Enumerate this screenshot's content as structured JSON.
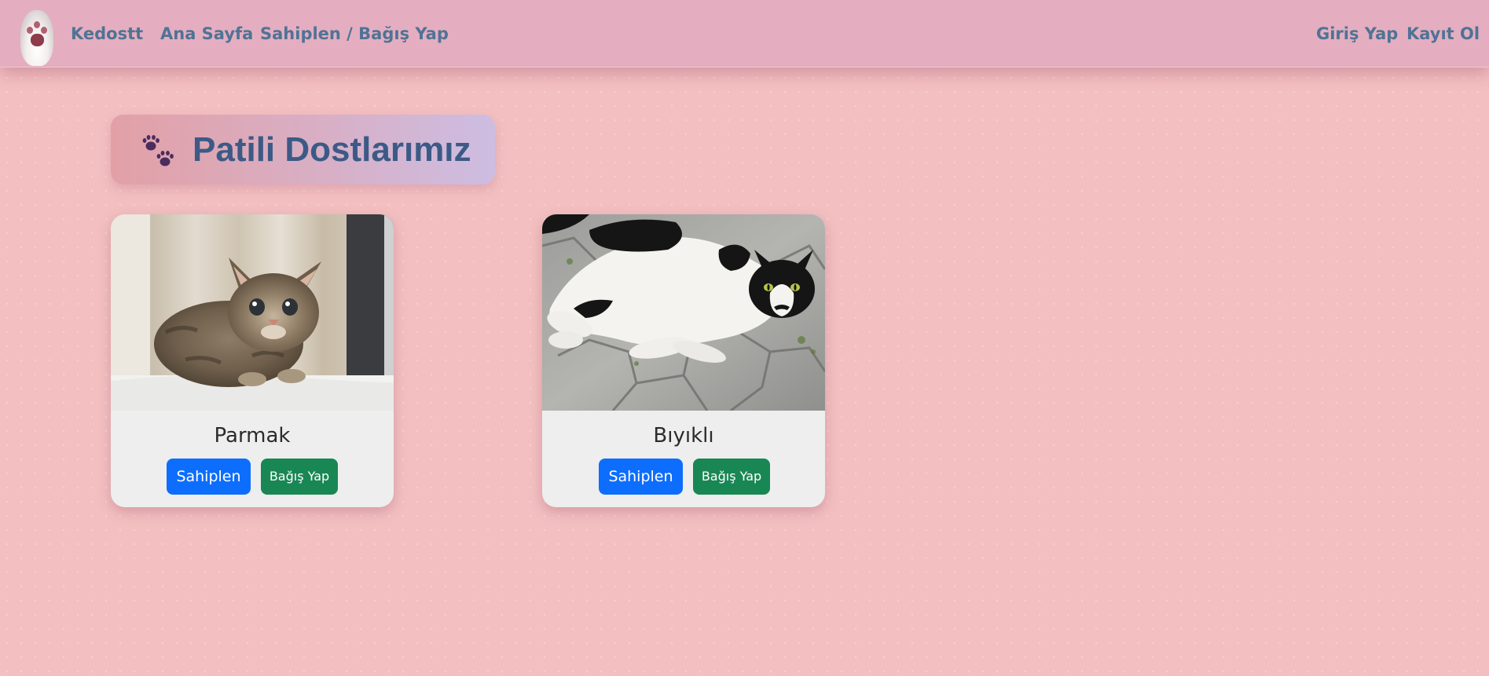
{
  "navbar": {
    "brand": "Kedostt",
    "links": {
      "home": "Ana Sayfa",
      "adopt_donate": "Sahiplen / Bağış Yap",
      "login": "Giriş Yap",
      "register": "Kayıt Ol"
    },
    "logo_icon": "cat-paw-logo"
  },
  "page": {
    "title": "Patili Dostlarımız",
    "title_icon": "paw-prints-icon"
  },
  "cats": [
    {
      "name": "Parmak",
      "photo": "tabby-kitten-photo",
      "adopt_label": "Sahiplen",
      "donate_label": "Bağış Yap"
    },
    {
      "name": "Bıyıklı",
      "photo": "black-white-cat-photo",
      "adopt_label": "Sahiplen",
      "donate_label": "Bağış Yap"
    }
  ],
  "colors": {
    "background": "#f3bfc0",
    "navbar": "#e4aec0",
    "nav_text": "#4f7395",
    "title_text": "#3c5a86",
    "adopt_button": "#0d6efd",
    "donate_button": "#198754",
    "card": "#eeeeee"
  }
}
